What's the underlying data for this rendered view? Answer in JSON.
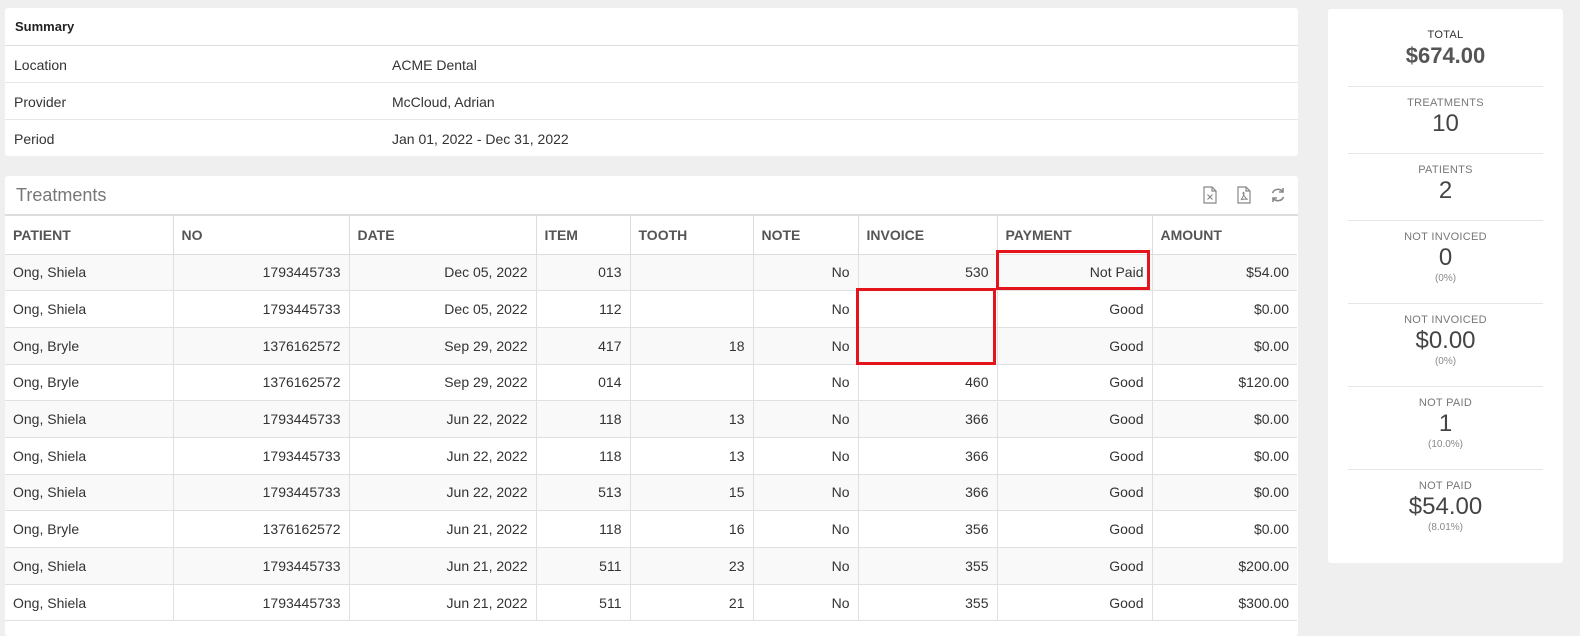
{
  "summary": {
    "heading": "Summary",
    "rows": [
      {
        "label": "Location",
        "value": "ACME Dental"
      },
      {
        "label": "Provider",
        "value": "McCloud, Adrian"
      },
      {
        "label": "Period",
        "value": "Jan 01, 2022 - Dec 31, 2022"
      }
    ]
  },
  "treatments": {
    "title": "Treatments",
    "tools": [
      "excel-export-icon",
      "pdf-export-icon",
      "refresh-icon"
    ],
    "columns": [
      "PATIENT",
      "NO",
      "DATE",
      "ITEM",
      "TOOTH",
      "NOTE",
      "INVOICE",
      "PAYMENT",
      "AMOUNT"
    ],
    "rows": [
      [
        "Ong, Shiela",
        "1793445733",
        "Dec 05, 2022",
        "013",
        "",
        "No",
        "530",
        "Not Paid",
        "$54.00"
      ],
      [
        "Ong, Shiela",
        "1793445733",
        "Dec 05, 2022",
        "112",
        "",
        "No",
        "",
        "Good",
        "$0.00"
      ],
      [
        "Ong, Bryle",
        "1376162572",
        "Sep 29, 2022",
        "417",
        "18",
        "No",
        "",
        "Good",
        "$0.00"
      ],
      [
        "Ong, Bryle",
        "1376162572",
        "Sep 29, 2022",
        "014",
        "",
        "No",
        "460",
        "Good",
        "$120.00"
      ],
      [
        "Ong, Shiela",
        "1793445733",
        "Jun 22, 2022",
        "118",
        "13",
        "No",
        "366",
        "Good",
        "$0.00"
      ],
      [
        "Ong, Shiela",
        "1793445733",
        "Jun 22, 2022",
        "118",
        "13",
        "No",
        "366",
        "Good",
        "$0.00"
      ],
      [
        "Ong, Shiela",
        "1793445733",
        "Jun 22, 2022",
        "513",
        "15",
        "No",
        "366",
        "Good",
        "$0.00"
      ],
      [
        "Ong, Bryle",
        "1376162572",
        "Jun 21, 2022",
        "118",
        "16",
        "No",
        "356",
        "Good",
        "$0.00"
      ],
      [
        "Ong, Shiela",
        "1793445733",
        "Jun 21, 2022",
        "511",
        "23",
        "No",
        "355",
        "Good",
        "$200.00"
      ],
      [
        "Ong, Shiela",
        "1793445733",
        "Jun 21, 2022",
        "511",
        "21",
        "No",
        "355",
        "Good",
        "$300.00"
      ]
    ]
  },
  "stats": [
    {
      "label": "TOTAL",
      "value": "$674.00",
      "pct": ""
    },
    {
      "label": "TREATMENTS",
      "value": "10",
      "pct": ""
    },
    {
      "label": "PATIENTS",
      "value": "2",
      "pct": ""
    },
    {
      "label": "NOT INVOICED",
      "value": "0",
      "pct": "(0%)"
    },
    {
      "label": "NOT INVOICED",
      "value": "$0.00",
      "pct": "(0%)"
    },
    {
      "label": "NOT PAID",
      "value": "1",
      "pct": "(10.0%)"
    },
    {
      "label": "NOT PAID",
      "value": "$54.00",
      "pct": "(8.01%)"
    }
  ],
  "colors": {
    "highlight": "#e3141b",
    "background": "#efefef"
  }
}
